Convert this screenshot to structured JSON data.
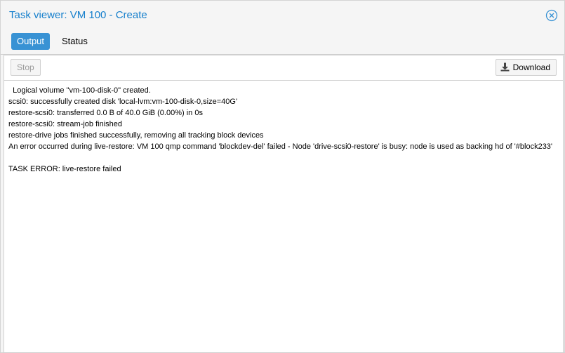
{
  "window": {
    "title": "Task viewer: VM 100 - Create"
  },
  "tabs": [
    {
      "label": "Output",
      "active": true
    },
    {
      "label": "Status",
      "active": false
    }
  ],
  "toolbar": {
    "stop_label": "Stop",
    "download_label": "Download"
  },
  "log": {
    "lines": [
      "  Logical volume \"vm-100-disk-0\" created.",
      "scsi0: successfully created disk 'local-lvm:vm-100-disk-0,size=40G'",
      "restore-scsi0: transferred 0.0 B of 40.0 GiB (0.00%) in 0s",
      "restore-scsi0: stream-job finished",
      "restore-drive jobs finished successfully, removing all tracking block devices",
      "An error occurred during live-restore: VM 100 qmp command 'blockdev-del' failed - Node 'drive-scsi0-restore' is busy: node is used as backing hd of '#block233'",
      "",
      "TASK ERROR: live-restore failed"
    ]
  },
  "colors": {
    "accent": "#157fcc",
    "active_tab": "#3892d4"
  },
  "icons": {
    "close": "close-circle-icon",
    "download": "download-icon"
  }
}
